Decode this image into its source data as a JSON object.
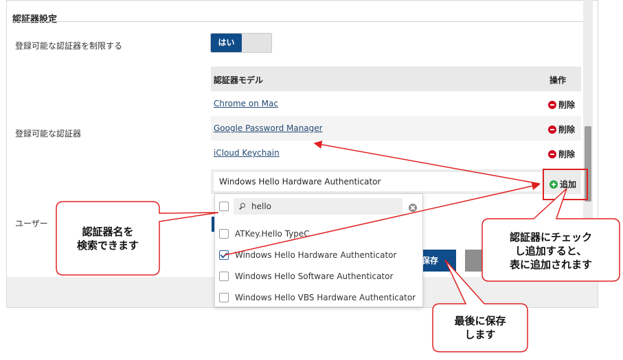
{
  "section_title": "認証器設定",
  "restrict": {
    "label": "登録可能な認証器を制限する",
    "toggle_on_label": "はい"
  },
  "allowed": {
    "label": "登録可能な認証器",
    "table": {
      "col_model": "認証器モデル",
      "col_action": "操作",
      "rows": [
        {
          "name": "Chrome on Mac",
          "action": "削除"
        },
        {
          "name": "Google Password Manager",
          "action": "削除"
        },
        {
          "name": "iCloud Keychain",
          "action": "削除"
        }
      ],
      "add_value": "Windows Hello Hardware Authenticator",
      "add_label": "追加"
    }
  },
  "user_label_partial": "ユーザー",
  "dropdown": {
    "search_value": "hello",
    "options": [
      {
        "label": "ATKey.Hello TypeC",
        "checked": false
      },
      {
        "label": "Windows Hello Hardware Authenticator",
        "checked": true
      },
      {
        "label": "Windows Hello Software Authenticator",
        "checked": false
      },
      {
        "label": "Windows Hello VBS Hardware Authenticator",
        "checked": false
      }
    ]
  },
  "save_label": "保存",
  "callouts": {
    "search": [
      "認証器名を",
      "検索できます"
    ],
    "check": [
      "認証器にチェック",
      "し追加すると、",
      "表に追加されます"
    ],
    "save": [
      "最後に保存",
      "します"
    ]
  },
  "colors": {
    "primary": "#0f4c8a",
    "delete": "#d0021b",
    "add": "#27a844",
    "callout_border": "#e02020"
  },
  "icons": {
    "delete": "minus-circle-icon",
    "add": "plus-circle-icon",
    "search": "magnifier-icon",
    "clear": "clear-circle-icon"
  }
}
